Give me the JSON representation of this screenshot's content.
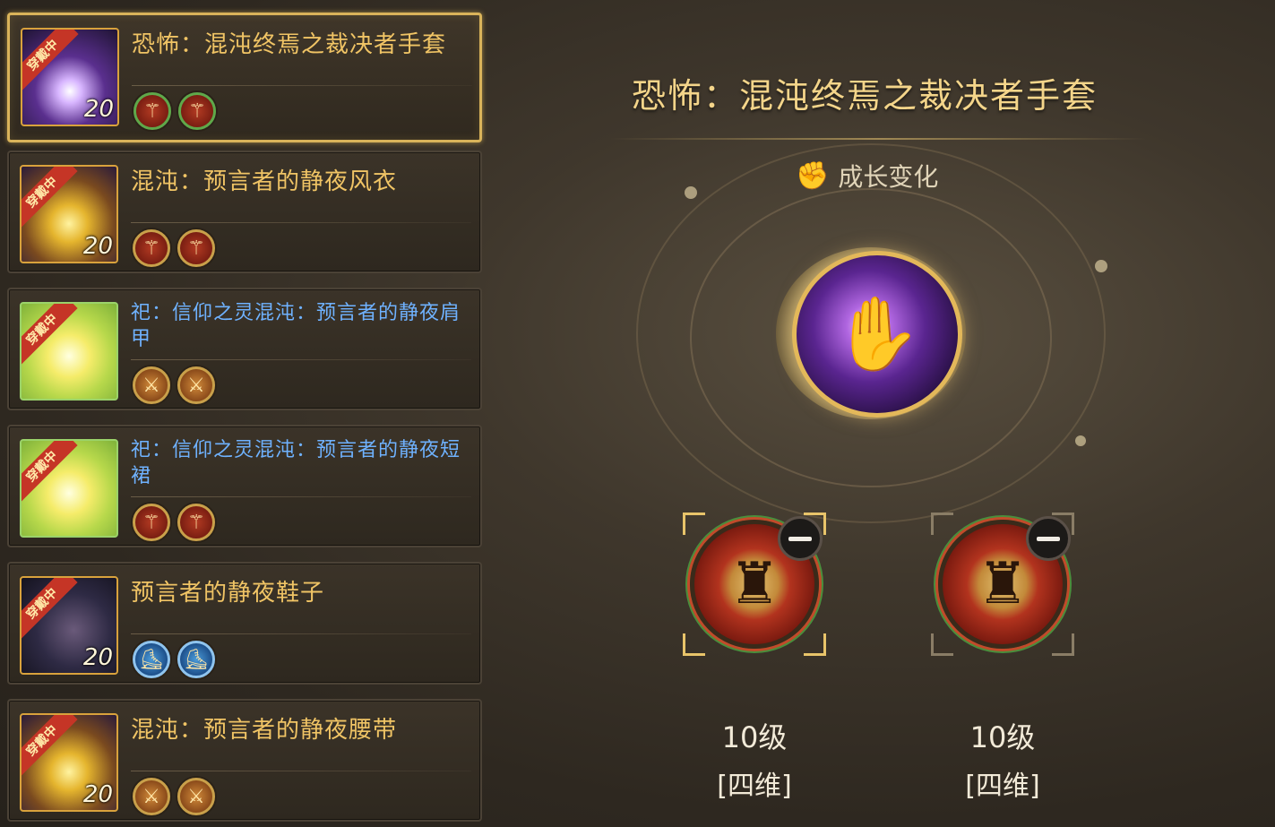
{
  "equipment_list": [
    {
      "ribbon": "穿戴中",
      "level": "20",
      "name": "恐怖：混沌终焉之裁决者手套",
      "prefix": "",
      "selected": true,
      "icons": [
        "strength-icon",
        "strength-icon"
      ]
    },
    {
      "ribbon": "穿戴中",
      "level": "20",
      "name": "混沌：预言者的静夜风衣",
      "prefix": "",
      "selected": false,
      "icons": [
        "strength-icon",
        "strength-icon"
      ]
    },
    {
      "ribbon": "穿戴中",
      "level": "",
      "name": "信仰之灵混沌：预言者的静夜肩甲",
      "prefix": "祀：",
      "selected": false,
      "icons": [
        "weapon-icon",
        "weapon-icon"
      ]
    },
    {
      "ribbon": "穿戴中",
      "level": "",
      "name": "信仰之灵混沌：预言者的静夜短裙",
      "prefix": "祀：",
      "selected": false,
      "icons": [
        "strength-icon",
        "strength-icon"
      ]
    },
    {
      "ribbon": "穿戴中",
      "level": "20",
      "name": "预言者的静夜鞋子",
      "prefix": "",
      "selected": false,
      "icons": [
        "boots-icon",
        "boots-icon"
      ]
    },
    {
      "ribbon": "穿戴中",
      "level": "20",
      "name": "混沌：预言者的静夜腰带",
      "prefix": "",
      "selected": false,
      "icons": [
        "weapon-icon",
        "weapon-icon"
      ]
    }
  ],
  "detail": {
    "title": "恐怖：混沌终焉之裁决者手套",
    "growth_label": "成长变化",
    "slots": [
      {
        "level": "10级",
        "kind": "[四维]"
      },
      {
        "level": "10级",
        "kind": "[四维]"
      }
    ]
  },
  "colors": {
    "gold": "#f0c465",
    "blue_text": "#6fb2ff",
    "border_gold": "#d9b35a",
    "badge_red": "#c53526"
  }
}
